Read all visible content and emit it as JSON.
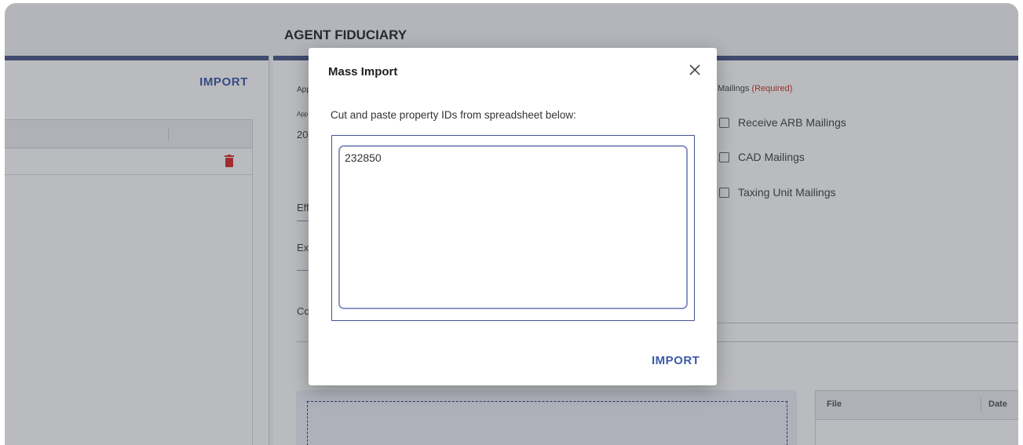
{
  "left_panel": {
    "import_label": "IMPORT"
  },
  "right_panel": {
    "title": "AGENT FIDUCIARY",
    "field_labels": [
      "App",
      "App",
      "20",
      "Eff",
      "Exp",
      "Co"
    ],
    "mailings": {
      "label": "Mailings",
      "required_text": "(Required)",
      "options": [
        "Receive ARB Mailings",
        "CAD Mailings",
        "Taxing Unit Mailings"
      ]
    },
    "files_table": {
      "columns": [
        "File",
        "Date"
      ]
    }
  },
  "modal": {
    "title": "Mass Import",
    "instructions": "Cut and paste property IDs from spreadsheet below:",
    "textarea_value": "232850\n",
    "import_label": "IMPORT"
  },
  "colors": {
    "accent": "#3d5aa8",
    "header_bar": "#4b5a8a",
    "required": "#c0392b",
    "trash": "#d9302c"
  }
}
